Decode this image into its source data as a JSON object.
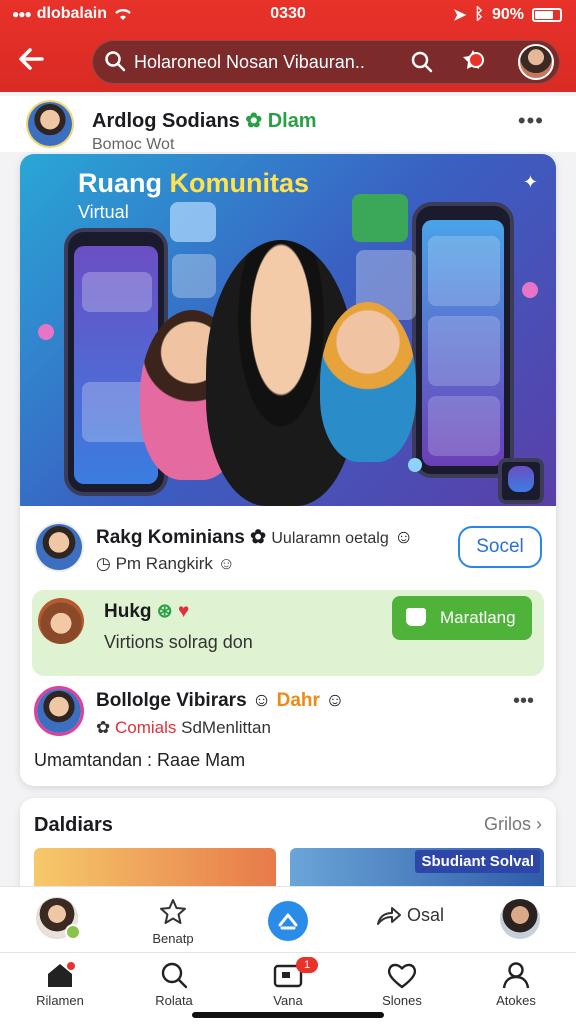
{
  "status_bar": {
    "carrier": "dlobalain",
    "time": "0330",
    "battery": "90%"
  },
  "header": {
    "search_text": "Holaroneol Nosan Vibauran.."
  },
  "post": {
    "author": "Ardlog Sodians",
    "author_badge": "Dlam",
    "subtitle": "Bomoc Wot"
  },
  "banner": {
    "title_white": "Ruang ",
    "title_yellow": "Komunitas",
    "subtitle": "Virtual"
  },
  "rows": {
    "r1": {
      "title": "Rakg Kominians",
      "title_extra": "Uularamn oetalg",
      "sub": "Pm  Rangkirk",
      "button": "Socel"
    },
    "r2": {
      "title": "Hukg",
      "sub": "Virtions solrag don",
      "button": "Maratlang"
    },
    "r3": {
      "title": "Bollolge Vibirars",
      "title_extra": "Dahr",
      "sub_red": "Comials",
      "sub": "SdMenlittan",
      "footer": "Umamtandan  :  Raae Mam"
    }
  },
  "section2": {
    "heading": "Daldiars",
    "link": "Grilos",
    "tag": "Sbudiant Solval"
  },
  "actions": {
    "star_label": "Benatp",
    "share_label": "Osal"
  },
  "nav": {
    "items": [
      {
        "label": "Rilamen",
        "icon": "home-icon"
      },
      {
        "label": "Rolata",
        "icon": "search-icon"
      },
      {
        "label": "Vana",
        "icon": "tv-icon",
        "badge": "1"
      },
      {
        "label": "Slones",
        "icon": "heart-icon"
      },
      {
        "label": "Atokes",
        "icon": "person-icon"
      }
    ]
  },
  "colors": {
    "brand_red": "#e8322a",
    "accent_blue": "#2a86e8",
    "green": "#4fb33a",
    "light_green": "#dff3d2"
  }
}
